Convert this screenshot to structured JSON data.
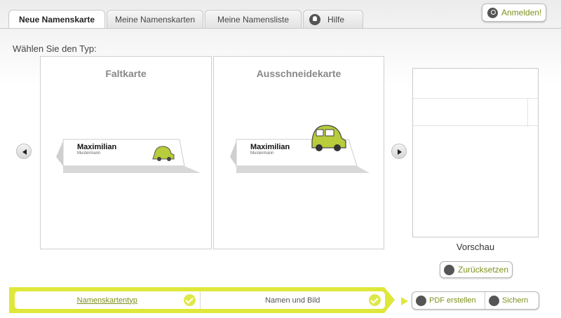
{
  "tabs": [
    {
      "label": "Neue Namenskarte",
      "active": true
    },
    {
      "label": "Meine Namenskarten",
      "active": false
    },
    {
      "label": "Meine Namensliste",
      "active": false
    },
    {
      "label": "Hilfe",
      "active": false,
      "icon": "lightbulb-icon"
    }
  ],
  "header": {
    "login_label": "Anmelden!",
    "login_icon": "key-icon"
  },
  "main": {
    "type_label": "Wählen Sie den Typ:",
    "cards": [
      {
        "title": "Faltkarte",
        "name": "Maximilian",
        "surname": "Mustermann"
      },
      {
        "title": "Ausschneidekarte",
        "name": "Maximilian",
        "surname": "Mustermann"
      }
    ],
    "prev_arrow": "arrow-left-icon",
    "next_arrow": "arrow-right-icon"
  },
  "preview": {
    "label": "Vorschau",
    "reset_label": "Zurücksetzen"
  },
  "steps": [
    {
      "label": "Namenskartentyp",
      "done": true
    },
    {
      "label": "Namen und Bild",
      "done": true
    }
  ],
  "actions": {
    "pdf_label": "PDF erstellen",
    "save_label": "Sichern"
  },
  "colors": {
    "accent": "#dfe83a",
    "link": "#7f8f1a",
    "car": "#b8cc3c"
  }
}
